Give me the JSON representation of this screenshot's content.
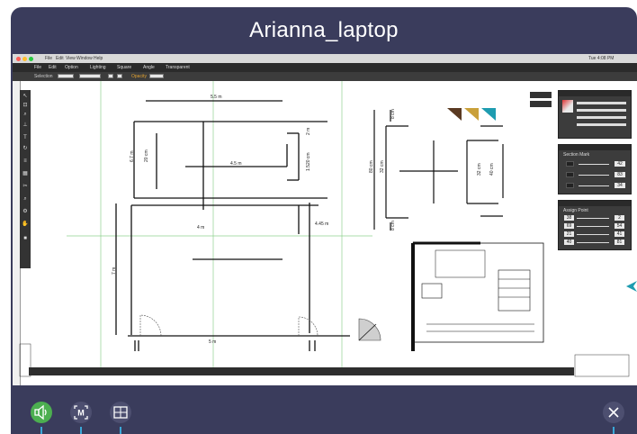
{
  "window": {
    "title": "Arianna_laptop"
  },
  "mac": {
    "menu": [
      "File",
      "Edit",
      "View",
      "Window",
      "Help"
    ],
    "time": "Tue 4:08 PM"
  },
  "app": {
    "menu": [
      "File",
      "Edit",
      "Option",
      "Lighting",
      "Square",
      "Angle",
      "Transparent"
    ]
  },
  "options": {
    "selection_label": "Selection",
    "opacity_label": "Opacity"
  },
  "plan": {
    "labels": {
      "a": "5.5 m",
      "b": "4.5 m",
      "c": "6.7 m",
      "d": "20 cm",
      "e": "2 m",
      "f": "1.520 cm",
      "g": "4 m",
      "h": "4.45 m",
      "i": "7 m",
      "j": "5 m",
      "k": "8 cm",
      "l": "80 cm",
      "m": "32 cm",
      "n": "8 cm",
      "o": "32 cm",
      "p": "40 cm"
    }
  },
  "panels": {
    "section_mark": {
      "title": "Section Mark",
      "values": [
        "42",
        "83",
        "34"
      ]
    },
    "assign_point": {
      "title": "Assign Point",
      "rows": [
        {
          "left": "38",
          "right": "2"
        },
        {
          "left": "69",
          "right": "54"
        },
        {
          "left": "21",
          "right": "41"
        },
        {
          "left": "40",
          "right": "81"
        }
      ]
    }
  },
  "colors": {
    "frame": "#3a3c5c",
    "speaker_active": "#4caf50",
    "marker_brown": "#5a3a22",
    "marker_gold": "#c9a03a",
    "marker_teal": "#1e9cb0",
    "guide_green": "#8fd18f",
    "indicator_blue": "#3aa8d8"
  },
  "controls": {
    "speaker": "speaker-icon",
    "mode": "m-frame-icon",
    "layout": "grid-icon",
    "close": "close-icon"
  }
}
